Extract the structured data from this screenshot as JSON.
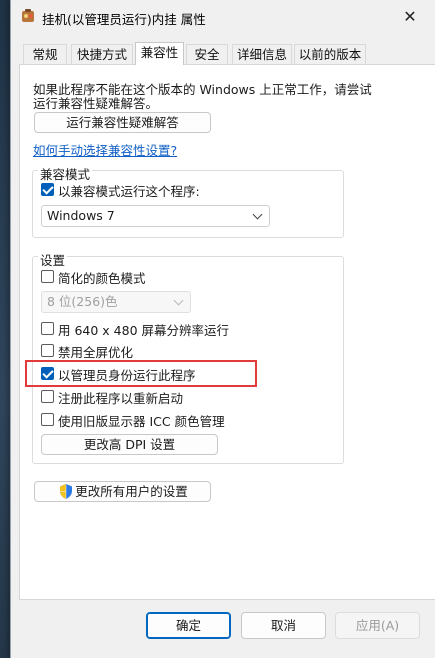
{
  "window": {
    "title": "挂机(以管理员运行)内挂 属性",
    "close_glyph": "✕"
  },
  "tabs": [
    {
      "label": "常规",
      "active": false
    },
    {
      "label": "快捷方式",
      "active": false
    },
    {
      "label": "兼容性",
      "active": true
    },
    {
      "label": "安全",
      "active": false
    },
    {
      "label": "详细信息",
      "active": false
    },
    {
      "label": "以前的版本",
      "active": false
    }
  ],
  "intro": {
    "line1": "如果此程序不能在这个版本的 Windows 上正常工作，请尝试",
    "line2": "运行兼容性疑难解答。"
  },
  "troubleshooter_button": "运行兼容性疑难解答",
  "manual_link": "如何手动选择兼容性设置?",
  "compat_mode": {
    "group_label": "兼容模式",
    "checkbox_label": "以兼容模式运行这个程序:",
    "checked": true,
    "selected_os": "Windows 7"
  },
  "settings": {
    "group_label": "设置",
    "reduced_color": {
      "label": "简化的颜色模式",
      "checked": false
    },
    "color_select": "8 位(256)色",
    "res_640": {
      "label": "用 640 x 480 屏幕分辨率运行",
      "checked": false
    },
    "disable_fullscreen": {
      "label": "禁用全屏优化",
      "checked": false
    },
    "run_as_admin": {
      "label": "以管理员身份运行此程序",
      "checked": true
    },
    "register_restart": {
      "label": "注册此程序以重新启动",
      "checked": false
    },
    "legacy_icc": {
      "label": "使用旧版显示器 ICC 颜色管理",
      "checked": false
    },
    "dpi_button": "更改高 DPI 设置"
  },
  "all_users_button": "更改所有用户的设置",
  "footer": {
    "ok": "确定",
    "cancel": "取消",
    "apply": "应用(A)"
  },
  "colors": {
    "accent": "#005fb8",
    "highlight_box": "#e13b3b",
    "link": "#0f5fc6"
  }
}
